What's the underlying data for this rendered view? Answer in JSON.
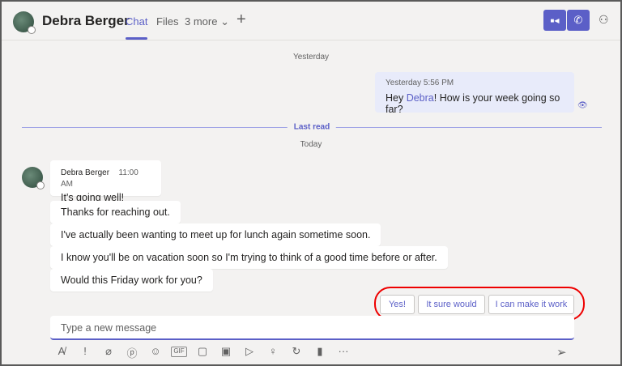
{
  "header": {
    "name": "Debra Berger",
    "tabs": [
      "Chat",
      "Files",
      "3 more ⌄"
    ],
    "add": "+",
    "video_icon": "■◀",
    "call_icon": "✆",
    "people_icon": "⚇"
  },
  "dividers": {
    "yesterday": "Yesterday",
    "last_read": "Last read",
    "today": "Today"
  },
  "my_message": {
    "time": "Yesterday 5:56 PM",
    "pre": "Hey ",
    "mention": "Debra",
    "post": "! How is your week going so far?",
    "seen_icon": "👁"
  },
  "their_messages": {
    "sender": "Debra Berger",
    "time": "11:00 AM",
    "messages": [
      "It's going well!",
      "Thanks for reaching out.",
      "I've actually been wanting to meet up for lunch again sometime soon.",
      "I know you'll be on vacation soon so I'm trying to think of a good time before or after.",
      "Would this Friday work for you?"
    ]
  },
  "suggested_replies": [
    "Yes!",
    "It sure would",
    "I can make it work"
  ],
  "compose": {
    "placeholder": "Type a new message",
    "tools": [
      "A̸",
      "!",
      "⌀",
      "ⓟ",
      "☺",
      "GIF",
      "▢",
      "▣",
      "▷",
      "♀",
      "↻",
      "▮",
      "···"
    ],
    "send": "➢"
  }
}
